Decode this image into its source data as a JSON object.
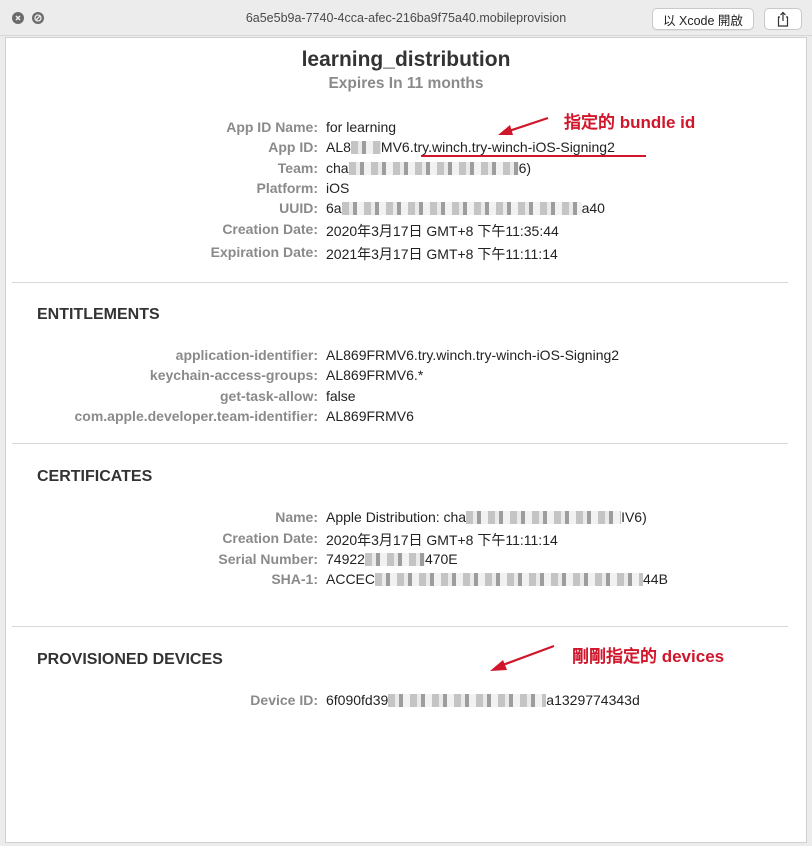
{
  "window": {
    "title": "6a5e5b9a-7740-4cca-afec-216ba9f75a40.mobileprovision",
    "open_xcode_label": "以 Xcode 開啟"
  },
  "profile": {
    "name": "learning_distribution",
    "expires": "Expires In 11 months",
    "fields": [
      {
        "label": "App ID Name:",
        "value": "for learning"
      },
      {
        "label": "App ID:",
        "value_prefix": "AL8",
        "value_suffix": "MV6.",
        "value_highlight": "try.winch.try-winch-iOS-Signing2"
      },
      {
        "label": "Team:",
        "value_prefix": "cha",
        "value_suffix": "6)"
      },
      {
        "label": "Platform:",
        "value": "iOS"
      },
      {
        "label": "UUID:",
        "value_prefix": "6a",
        "value_suffix": "a40"
      },
      {
        "label": "Creation Date:",
        "value": "2020年3月17日 GMT+8 下午11:35:44"
      },
      {
        "label": "Expiration Date:",
        "value": "2021年3月17日 GMT+8 下午11:11:14"
      }
    ]
  },
  "entitlements": {
    "heading": "ENTITLEMENTS",
    "fields": [
      {
        "label": "application-identifier:",
        "value": "AL869FRMV6.try.winch.try-winch-iOS-Signing2"
      },
      {
        "label": "keychain-access-groups:",
        "value": "AL869FRMV6.*"
      },
      {
        "label": "get-task-allow:",
        "value": "false"
      },
      {
        "label": "com.apple.developer.team-identifier:",
        "value": "AL869FRMV6"
      }
    ]
  },
  "certificates": {
    "heading": "CERTIFICATES",
    "fields": [
      {
        "label": "Name:",
        "value_prefix": "Apple Distribution: cha",
        "value_suffix": "IV6)"
      },
      {
        "label": "Creation Date:",
        "value": "2020年3月17日 GMT+8 下午11:11:14"
      },
      {
        "label": "Serial Number:",
        "value_prefix": "74922",
        "value_suffix": "470E"
      },
      {
        "label": "SHA-1:",
        "value_prefix": "ACCEC",
        "value_suffix": "44B"
      }
    ]
  },
  "devices": {
    "heading": "PROVISIONED DEVICES",
    "fields": [
      {
        "label": "Device ID:",
        "value_prefix": "6f090fd39",
        "value_suffix": "a1329774343d"
      }
    ]
  },
  "annotations": {
    "bundle_id_note": "指定的 bundle id",
    "devices_note": "剛剛指定的 devices",
    "color": "#d0162b"
  }
}
